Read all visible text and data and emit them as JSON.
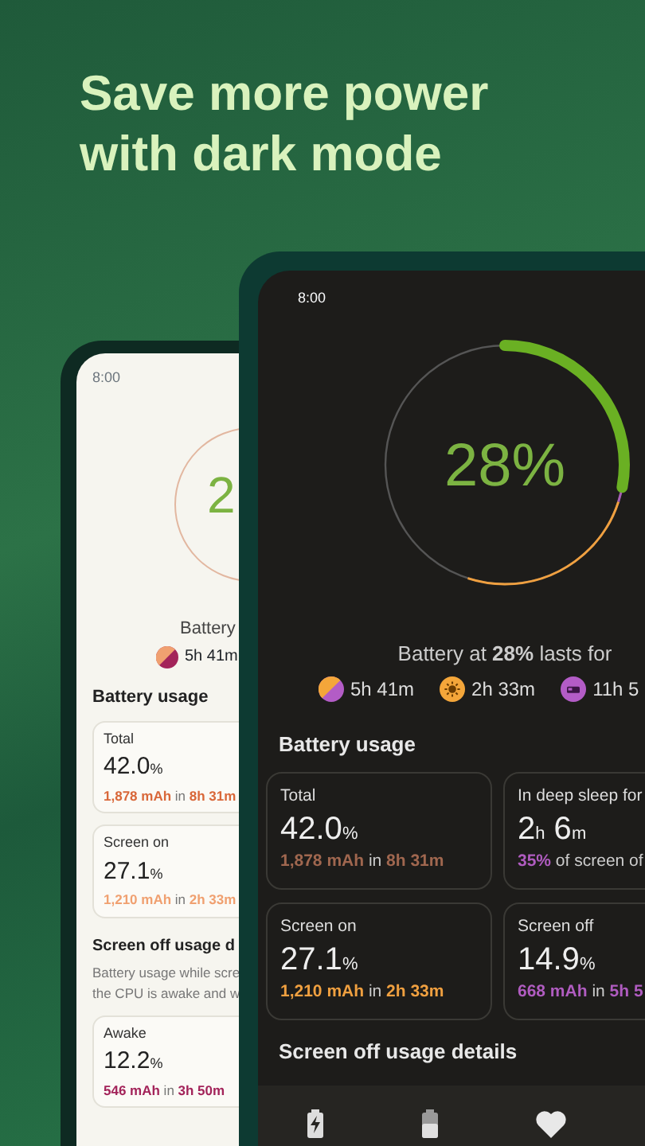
{
  "headline": "Save more power with dark mode",
  "light_phone": {
    "status_time": "8:00",
    "ring_text": "2",
    "summary": "Battery",
    "chip": {
      "kind": "mixed",
      "text": "5h 41m"
    },
    "section_title": "Battery usage",
    "cards": [
      {
        "label": "Total",
        "number": "42.0",
        "unit": "%",
        "amount": "1,878 mAh",
        "joiner": "in",
        "duration": "8h 31m",
        "color": "#d9683a"
      },
      {
        "label": "Screen on",
        "number": "27.1",
        "unit": "%",
        "amount": "1,210 mAh",
        "joiner": "in",
        "duration": "2h 33m",
        "color": "#f0a070"
      }
    ],
    "details_title": "Screen off usage d",
    "details_lines": [
      "Battery usage while scre",
      "the CPU is awake and w"
    ],
    "detail_cards": [
      {
        "label": "Awake",
        "number": "12.2",
        "unit": "%",
        "amount": "546 mAh",
        "joiner": "in",
        "duration": "3h 50m",
        "color": "#a3245a"
      }
    ]
  },
  "dark_phone": {
    "status_time": "8:00",
    "ring": {
      "text": "28%",
      "level": 0.28
    },
    "summary": "Battery at **28%** lasts for",
    "chips": [
      {
        "kind": "mixed",
        "text": "5h 41m"
      },
      {
        "kind": "screen_on",
        "text": "2h 33m"
      },
      {
        "kind": "screen_off",
        "text": "11h 5"
      }
    ],
    "section_title": "Battery usage",
    "cards": [
      {
        "label": "Total",
        "value": [
          {
            "n": "42.0",
            "u": "%"
          }
        ],
        "amount": "1,878 mAh",
        "joiner": "in",
        "duration": "8h 31m",
        "color": "#a0674f"
      },
      {
        "label": "In deep sleep for",
        "value": [
          {
            "n": "2",
            "u": "h"
          },
          {
            "n": "6",
            "u": "m"
          }
        ],
        "amount": "35%",
        "joiner": "of screen of",
        "color": "#b05cc0"
      },
      {
        "label": "Screen on",
        "value": [
          {
            "n": "27.1",
            "u": "%"
          }
        ],
        "amount": "1,210 mAh",
        "joiner": "in",
        "duration": "2h 33m",
        "color": "#f0a040"
      },
      {
        "label": "Screen off",
        "value": [
          {
            "n": "14.9",
            "u": "%"
          }
        ],
        "amount": "668 mAh",
        "joiner": "in",
        "duration": "5h 5",
        "color": "#b05cc0"
      }
    ],
    "details_title": "Screen off usage details",
    "bottom_nav": [
      {
        "kind": "charging"
      },
      {
        "kind": "battery"
      },
      {
        "kind": "heart"
      }
    ]
  }
}
